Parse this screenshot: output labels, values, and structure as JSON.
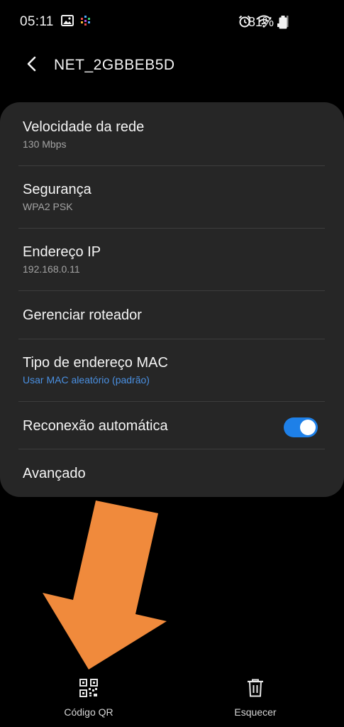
{
  "status_bar": {
    "time": "05:11",
    "battery_percent": "81%",
    "icons_left": [
      "image-icon",
      "app-notification-icon"
    ],
    "icons_right": [
      "alarm-icon",
      "wifi-icon",
      "signal-icon",
      "battery-icon"
    ]
  },
  "header": {
    "title": "NET_2GBBEB5D",
    "back_icon": "back-arrow-icon"
  },
  "settings": [
    {
      "title": "Velocidade da rede",
      "subtitle": "130 Mbps"
    },
    {
      "title": "Segurança",
      "subtitle": "WPA2 PSK"
    },
    {
      "title": "Endereço IP",
      "subtitle": "192.168.0.11"
    },
    {
      "title": "Gerenciar roteador"
    },
    {
      "title": "Tipo de endereço MAC",
      "subtitle": "Usar MAC aleatório (padrão)"
    },
    {
      "title": "Reconexão automática",
      "toggle_on": true
    },
    {
      "title": "Avançado"
    }
  ],
  "bottom_bar": {
    "qr_label": "Código QR",
    "forget_label": "Esquecer"
  },
  "colors": {
    "background": "#000000",
    "card": "#262626",
    "accent": "#4a90e2",
    "toggle": "#1e80e8",
    "annotation_arrow": "#f08a3c"
  }
}
